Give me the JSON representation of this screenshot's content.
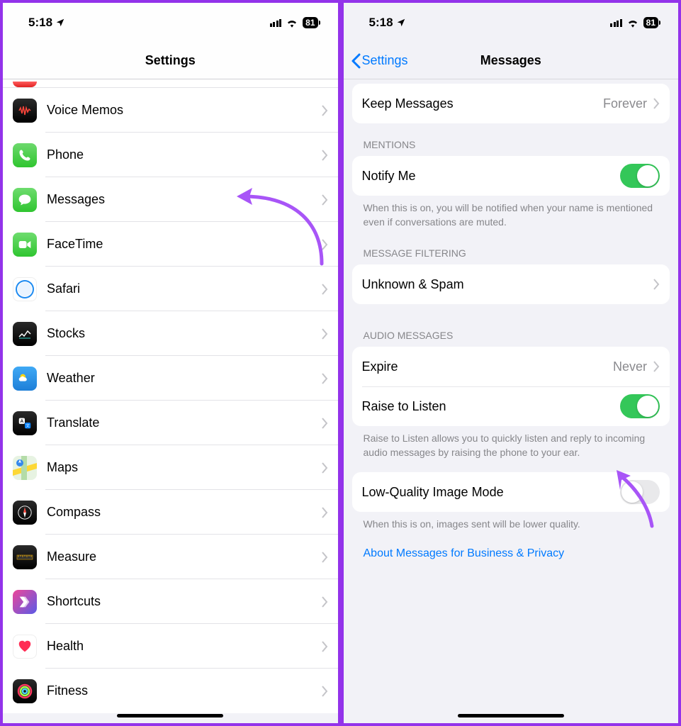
{
  "status": {
    "time": "5:18",
    "battery": "81"
  },
  "left": {
    "title": "Settings",
    "items": [
      {
        "label": "Voice Memos"
      },
      {
        "label": "Phone"
      },
      {
        "label": "Messages"
      },
      {
        "label": "FaceTime"
      },
      {
        "label": "Safari"
      },
      {
        "label": "Stocks"
      },
      {
        "label": "Weather"
      },
      {
        "label": "Translate"
      },
      {
        "label": "Maps"
      },
      {
        "label": "Compass"
      },
      {
        "label": "Measure"
      },
      {
        "label": "Shortcuts"
      },
      {
        "label": "Health"
      },
      {
        "label": "Fitness"
      }
    ]
  },
  "right": {
    "back": "Settings",
    "title": "Messages",
    "keep_messages_label": "Keep Messages",
    "keep_messages_value": "Forever",
    "mentions_header": "MENTIONS",
    "notify_me_label": "Notify Me",
    "mentions_footer": "When this is on, you will be notified when your name is mentioned even if conversations are muted.",
    "filtering_header": "MESSAGE FILTERING",
    "filtering_label": "Unknown & Spam",
    "audio_header": "AUDIO MESSAGES",
    "expire_label": "Expire",
    "expire_value": "Never",
    "raise_label": "Raise to Listen",
    "audio_footer": "Raise to Listen allows you to quickly listen and reply to incoming audio messages by raising the phone to your ear.",
    "low_quality_label": "Low-Quality Image Mode",
    "low_quality_footer": "When this is on, images sent will be lower quality.",
    "about_link": "About Messages for Business & Privacy"
  }
}
